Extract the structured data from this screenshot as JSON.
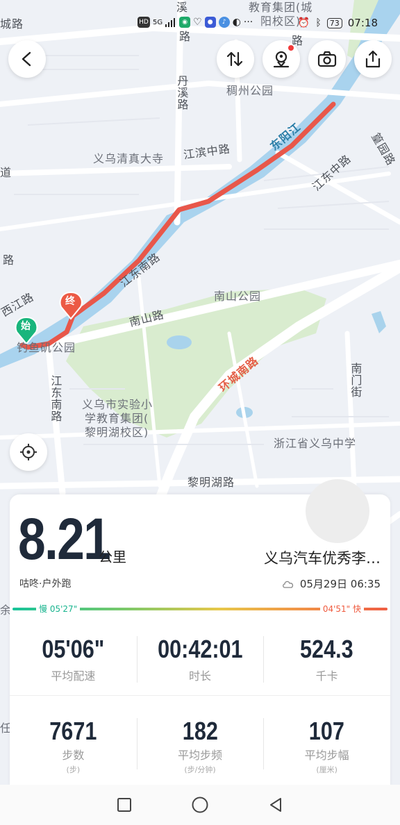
{
  "status_bar": {
    "left_icons": [
      "hd-icon",
      "5g-icon",
      "signal-icon",
      "app-icon-green",
      "heart-icon",
      "chat-icon",
      "qq-icon",
      "music-icon",
      "more-dots"
    ],
    "battery": "73",
    "time": "07:18"
  },
  "map": {
    "labels": {
      "top_left": "城路",
      "xi": "溪",
      "lu_top": "路",
      "jiaoyu": "教育集团(城",
      "yangxiao": "阳校区)",
      "lu_right": "路",
      "danxi": "丹溪路",
      "chouzhou_park": "稠州公园",
      "dongyang_river": "东阳江",
      "qingzhen": "义乌清真大寺",
      "jiangbin": "江滨中路",
      "jiangdong_zhong": "江东中路",
      "xuanyuan": "篁园路",
      "dao": "道",
      "lu_left": "路",
      "jiangdong_nan_diag": "江东南路",
      "nanshan_park": "南山公园",
      "xijiang": "西江路",
      "nanshan_road": "南山路",
      "huancheng": "环城南路",
      "park_bottom": "钓鱼矶公园",
      "jiangdong_nan_vert": "江东南路",
      "nanmen": "南门街",
      "school": "义乌市实验小",
      "school2": "学教育集团(",
      "school3": "黎明湖校区)",
      "zhejiang_school": "浙江省义乌中学",
      "liminghu": "黎明湖路",
      "yu": "余",
      "ren": "任"
    },
    "start_marker": "始",
    "end_marker": "终"
  },
  "run": {
    "distance": "8.21",
    "distance_unit": "公里",
    "title": "义乌汽车优秀李…",
    "type": "咕咚·户外跑",
    "date": "05月29日 06:35",
    "pace_slow": "慢 05'27\"",
    "pace_fast": "04'51\" 快"
  },
  "stats_row_1": [
    {
      "value": "05'06\"",
      "label": "平均配速"
    },
    {
      "value": "00:42:01",
      "label": "时长"
    },
    {
      "value": "524.3",
      "label": "千卡"
    }
  ],
  "stats_row_2": [
    {
      "value": "7671",
      "label": "步数",
      "unit": "(步)"
    },
    {
      "value": "182",
      "label": "平均步频",
      "unit": "(步/分钟)"
    },
    {
      "value": "107",
      "label": "平均步幅",
      "unit": "(厘米)"
    }
  ],
  "colors": {
    "route": "#e8574a",
    "river": "#a7d3ee",
    "park": "#d9eccf",
    "start_marker": "#19b57c",
    "end_marker": "#ec5a45"
  }
}
